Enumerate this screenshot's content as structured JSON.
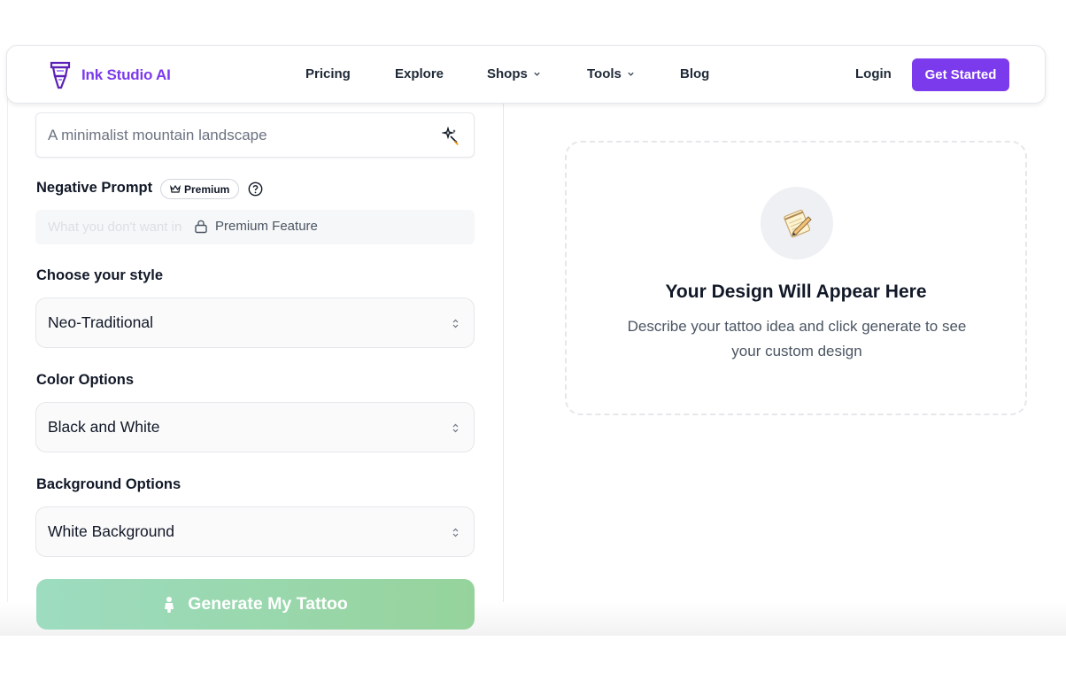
{
  "brand": {
    "name": "Ink Studio AI",
    "accent": "#7c3aed"
  },
  "nav": {
    "items": [
      {
        "label": "Pricing",
        "dropdown": false
      },
      {
        "label": "Explore",
        "dropdown": false
      },
      {
        "label": "Shops",
        "dropdown": true
      },
      {
        "label": "Tools",
        "dropdown": true
      },
      {
        "label": "Blog",
        "dropdown": false
      }
    ],
    "login": "Login",
    "get_started": "Get Started"
  },
  "form": {
    "prompt": {
      "value": "A minimalist mountain landscape",
      "icon": "magic-wand-icon"
    },
    "negative": {
      "label": "Negative Prompt",
      "badge": "Premium",
      "placeholder": "What you don't want in",
      "lock_text": "Premium Feature"
    },
    "style": {
      "label": "Choose your style",
      "value": "Neo-Traditional"
    },
    "color": {
      "label": "Color Options",
      "value": "Black and White"
    },
    "background": {
      "label": "Background Options",
      "value": "White Background"
    },
    "generate": {
      "label": "Generate My Tattoo",
      "color_start": "#9ddcc0",
      "color_end": "#96d39c"
    }
  },
  "preview": {
    "icon": "memo-icon",
    "title": "Your Design Will Appear Here",
    "description": "Describe your tattoo idea and click generate to see your custom design"
  }
}
